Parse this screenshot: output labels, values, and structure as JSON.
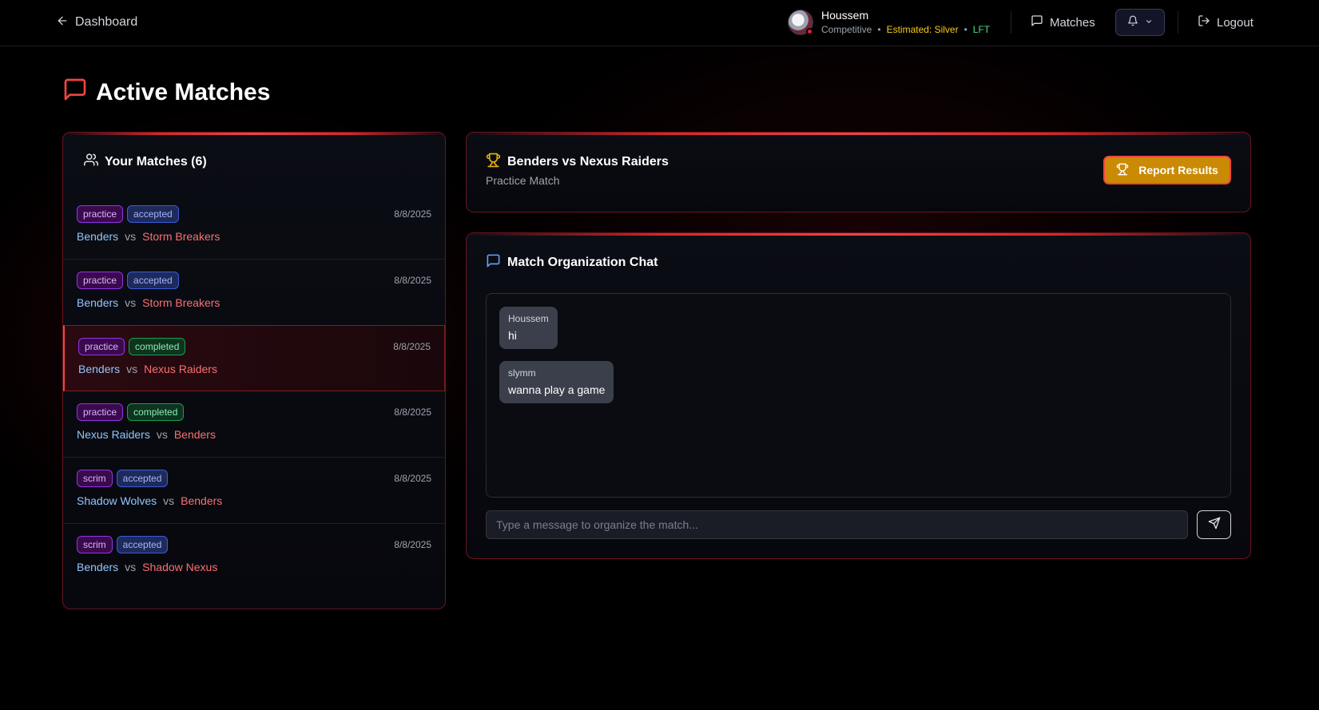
{
  "header": {
    "back_label": "Dashboard",
    "user": {
      "name": "Houssem",
      "mode": "Competitive",
      "rank": "Estimated: Silver",
      "status": "LFT",
      "separator": "•"
    },
    "nav_matches_label": "Matches",
    "logout_label": "Logout"
  },
  "page": {
    "title": "Active Matches"
  },
  "matches_panel": {
    "title": "Your Matches (6)",
    "vs_label": "vs",
    "items": [
      {
        "type": "practice",
        "status": "accepted",
        "date": "8/8/2025",
        "team_a": "Benders",
        "team_b": "Storm Breakers",
        "selected": false
      },
      {
        "type": "practice",
        "status": "accepted",
        "date": "8/8/2025",
        "team_a": "Benders",
        "team_b": "Storm Breakers",
        "selected": false
      },
      {
        "type": "practice",
        "status": "completed",
        "date": "8/8/2025",
        "team_a": "Benders",
        "team_b": "Nexus Raiders",
        "selected": true
      },
      {
        "type": "practice",
        "status": "completed",
        "date": "8/8/2025",
        "team_a": "Nexus Raiders",
        "team_b": "Benders",
        "selected": false
      },
      {
        "type": "scrim",
        "status": "accepted",
        "date": "8/8/2025",
        "team_a": "Shadow Wolves",
        "team_b": "Benders",
        "selected": false
      },
      {
        "type": "scrim",
        "status": "accepted",
        "date": "8/8/2025",
        "team_a": "Benders",
        "team_b": "Shadow Nexus",
        "selected": false
      }
    ]
  },
  "match_detail": {
    "title": "Benders vs Nexus Raiders",
    "subtitle": "Practice Match",
    "report_button_label": "Report Results"
  },
  "chat": {
    "title": "Match Organization Chat",
    "messages": [
      {
        "author": "Houssem",
        "text": "hi"
      },
      {
        "author": "slymm",
        "text": "wanna play a game"
      }
    ],
    "input_placeholder": "Type a message to organize the match..."
  },
  "icons": {
    "back": "arrow-left-icon",
    "matches": "message-square-icon",
    "bell": "bell-icon",
    "logout": "logout-icon",
    "users": "users-icon",
    "trophy": "trophy-icon",
    "send": "send-icon"
  },
  "colors": {
    "accent": "#ef4444",
    "trophy": "#eab308",
    "report_button": "#ca8a04",
    "chat_icon": "#60a5fa"
  }
}
